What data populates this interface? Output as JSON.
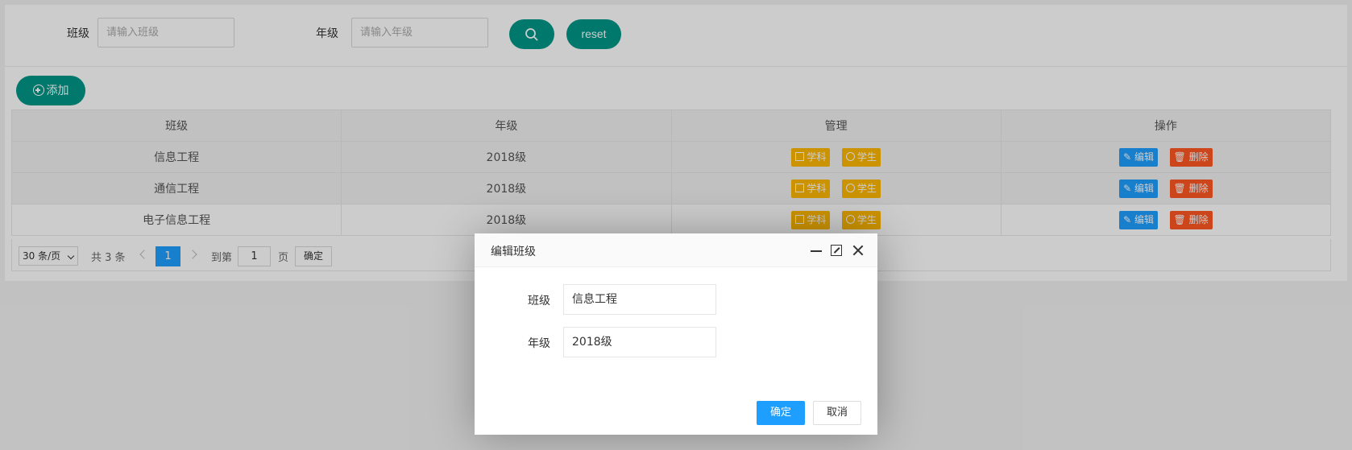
{
  "search": {
    "class_label": "班级",
    "class_placeholder": "请输入班级",
    "grade_label": "年级",
    "grade_placeholder": "请输入年级",
    "search_icon": "search-icon",
    "reset_label": "reset"
  },
  "toolbar": {
    "add_label": "添加",
    "add_icon": "plus-circle-icon"
  },
  "table": {
    "headers": [
      "班级",
      "年级",
      "管理",
      "操作"
    ],
    "rows": [
      {
        "class": "信息工程",
        "grade": "2018级"
      },
      {
        "class": "通信工程",
        "grade": "2018级"
      },
      {
        "class": "电子信息工程",
        "grade": "2018级"
      }
    ],
    "subject_btn": "学科",
    "student_btn": "学生",
    "edit_btn": "编辑",
    "delete_btn": "删除"
  },
  "pager": {
    "page_size": "30 条/页",
    "total": "共 3 条",
    "current_page": "1",
    "goto_label": "到第",
    "goto_value": "1",
    "page_suffix": "页",
    "confirm": "确定"
  },
  "dialog": {
    "title": "编辑班级",
    "class_label": "班级",
    "class_value": "信息工程",
    "grade_label": "年级",
    "grade_value": "2018级",
    "ok_label": "确定",
    "cancel_label": "取消"
  },
  "colors": {
    "green": "#009688",
    "blue": "#1e9fff",
    "yellow": "#ffb800",
    "red": "#ff5722"
  }
}
